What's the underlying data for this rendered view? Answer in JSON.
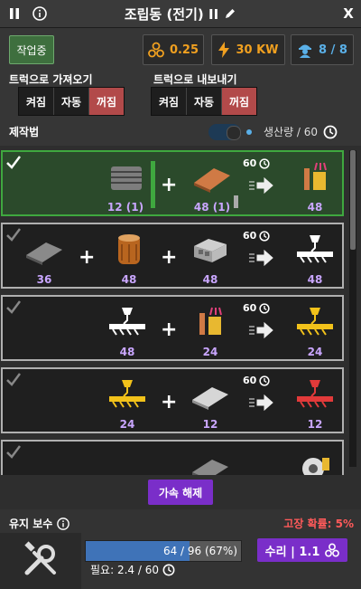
{
  "window": {
    "title": "조립동 (전기) II",
    "close": "X"
  },
  "status": {
    "working": "작업중",
    "stat1": "0.25",
    "power": "30 KW",
    "workers": "8 / 8"
  },
  "import_label": "트럭으로 가져오기",
  "export_label": "트럭으로 내보내기",
  "modes": [
    "켜짐",
    "자동",
    "꺼짐"
  ],
  "recipes_label": "제작법",
  "production": "생산량 / 60",
  "recipes": [
    {
      "time": "60",
      "inputs": [
        {
          "qty": "12 (1)"
        },
        {
          "qty": "48 (1)"
        }
      ],
      "output": "48"
    },
    {
      "time": "60",
      "inputs": [
        {
          "qty": "36"
        },
        {
          "qty": "48"
        },
        {
          "qty": "48"
        }
      ],
      "output": "48"
    },
    {
      "time": "60",
      "inputs": [
        {
          "qty": "48"
        },
        {
          "qty": "24"
        }
      ],
      "output": "24"
    },
    {
      "time": "60",
      "inputs": [
        {
          "qty": "24"
        },
        {
          "qty": "12"
        }
      ],
      "output": "12"
    },
    {
      "time": "",
      "inputs": [
        {
          "qty": ""
        }
      ],
      "output": ""
    }
  ],
  "accel_button": "가속 해제",
  "maintenance": {
    "label": "유지 보수",
    "failure": "고장 확률: 5%",
    "progress_text": "64 / 96 (67%)",
    "progress": 0.67,
    "need": "필요: 2.4 / 60",
    "repair": "수리 | 1.1"
  },
  "colors": {
    "accent": "#7a2ec9",
    "active": "#3fa83f",
    "danger": "#b24a4a",
    "qty": "#c9a6ff"
  }
}
